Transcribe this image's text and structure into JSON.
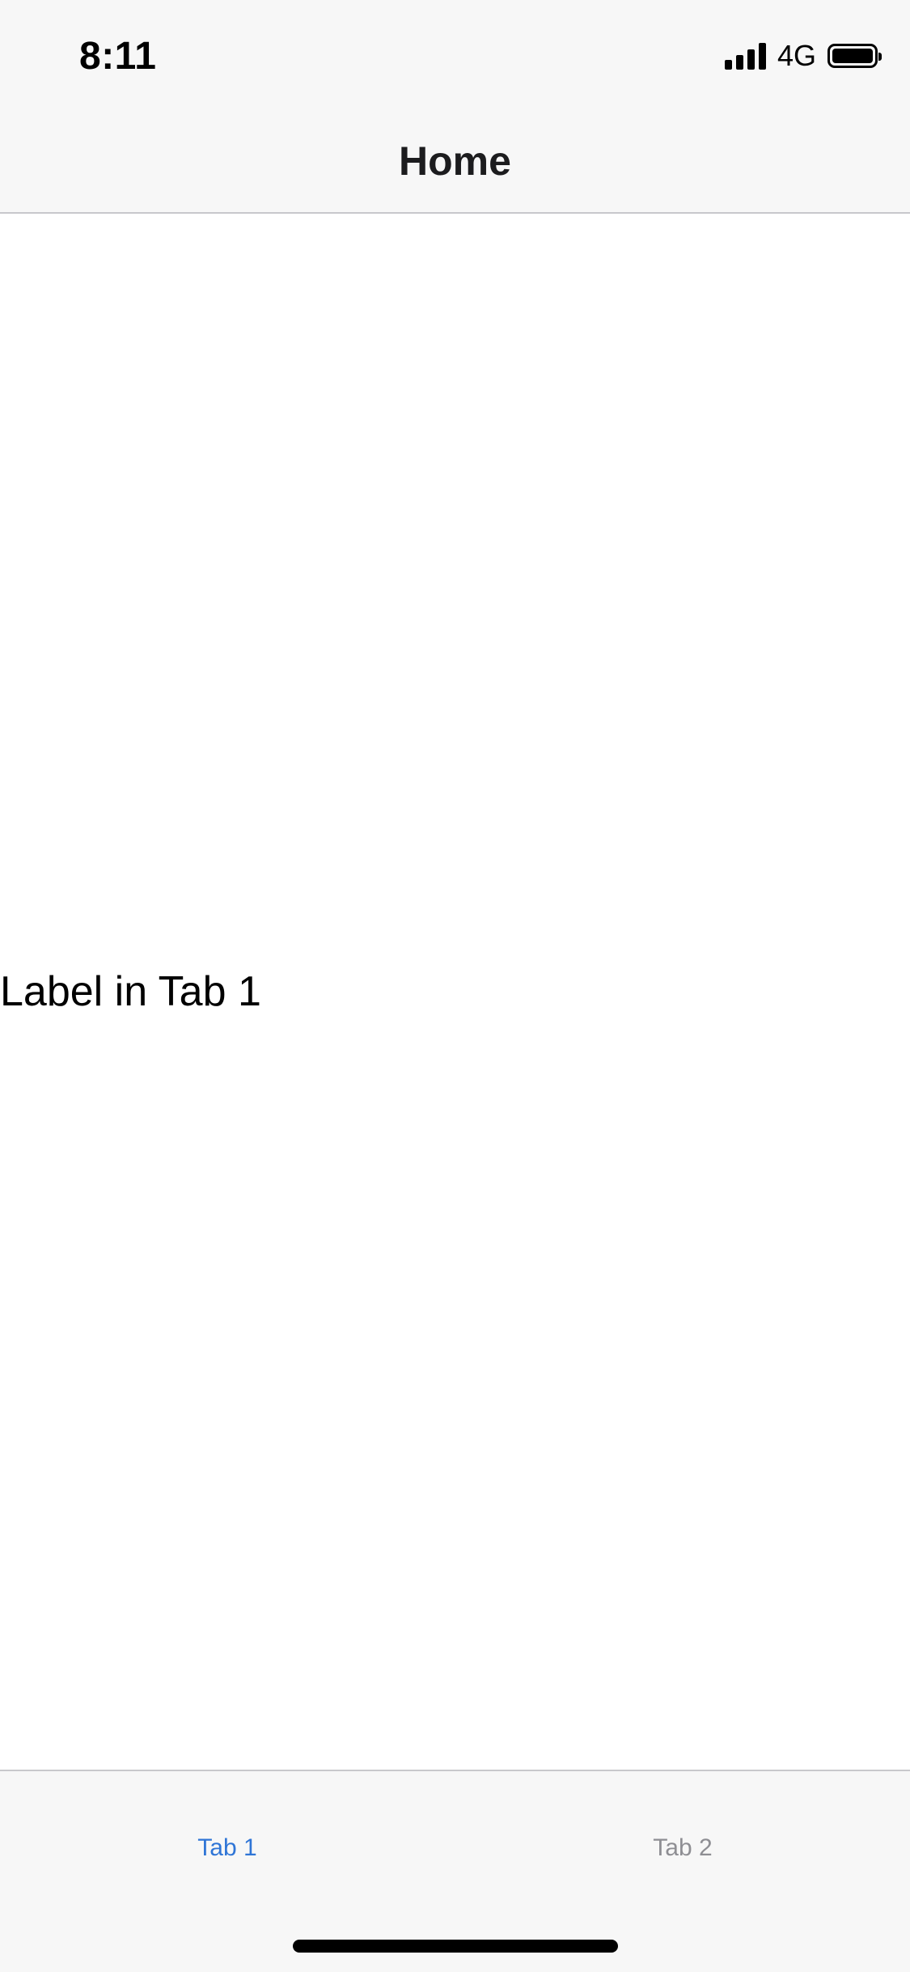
{
  "status_bar": {
    "time": "8:11",
    "network": "4G",
    "icons": [
      "signal-icon",
      "battery-icon"
    ]
  },
  "nav": {
    "title": "Home"
  },
  "content": {
    "label": "Label in Tab 1"
  },
  "tab_bar": {
    "tabs": [
      {
        "label": "Tab 1",
        "selected": true
      },
      {
        "label": "Tab 2",
        "selected": false
      }
    ]
  },
  "colors": {
    "accent": "#2f75d6",
    "inactive_tab": "#8e8e93",
    "bar_background": "#f7f7f7",
    "separator": "#c8c8cc"
  }
}
